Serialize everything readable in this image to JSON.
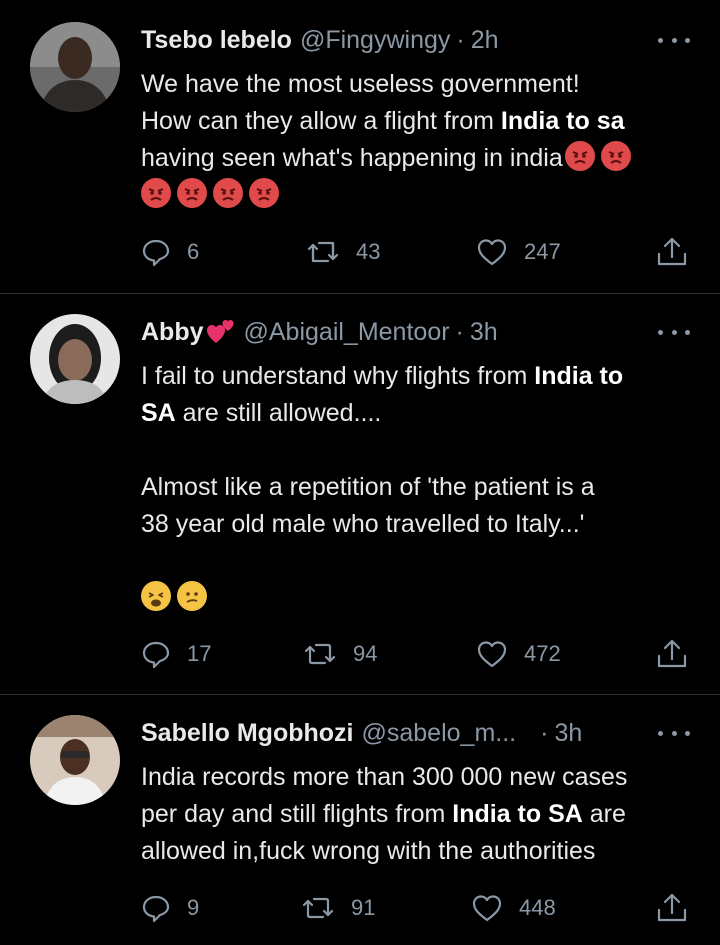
{
  "tweets": [
    {
      "name": "Tsebo lebelo",
      "handle": "@Fingywingy",
      "dot": "·",
      "time": "2h",
      "line1": "We have the most useless government!",
      "line2_pre": "How can they allow a flight from ",
      "line2_bold": "India to sa",
      "line3": "having seen what's happening in india",
      "replies": "6",
      "retweets": "43",
      "likes": "247",
      "avatar_color": "#5a4a40",
      "emoji_icons": [
        "angry-face-icon",
        "angry-face-icon",
        "angry-face-icon",
        "angry-face-icon",
        "angry-face-icon",
        "angry-face-icon"
      ]
    },
    {
      "name": "Abby",
      "name_emoji": "two-hearts-icon",
      "handle": "@Abigail_Mentoor",
      "dot": "·",
      "time": "3h",
      "line1_pre": "I fail to understand why flights from ",
      "line1_bold": "India to",
      "line2_bold": "SA",
      "line2_post": " are still allowed....",
      "line3": "Almost like a repetition of 'the patient is a",
      "line4": "38 year old male who travelled to Italy...'",
      "replies": "17",
      "retweets": "94",
      "likes": "472",
      "avatar_color": "#dcdcdc",
      "emoji_icons": [
        "weary-face-icon",
        "confused-face-icon"
      ]
    },
    {
      "name": "Sabello Mgobhozi",
      "handle": "@sabelo_m...",
      "dot": "·",
      "time": "3h",
      "line1": "India records more than 300 000 new cases",
      "line2_pre": "per day and still flights from ",
      "line2_bold": "India to SA",
      "line2_post": " are",
      "line3": "allowed in,fuck wrong with the authorities",
      "replies": "9",
      "retweets": "91",
      "likes": "448",
      "avatar_color": "#c9b8a6"
    }
  ],
  "colors": {
    "background": "#000000",
    "text": "#e7e9ea",
    "muted": "#8b98a5",
    "divider": "#2f3336"
  }
}
